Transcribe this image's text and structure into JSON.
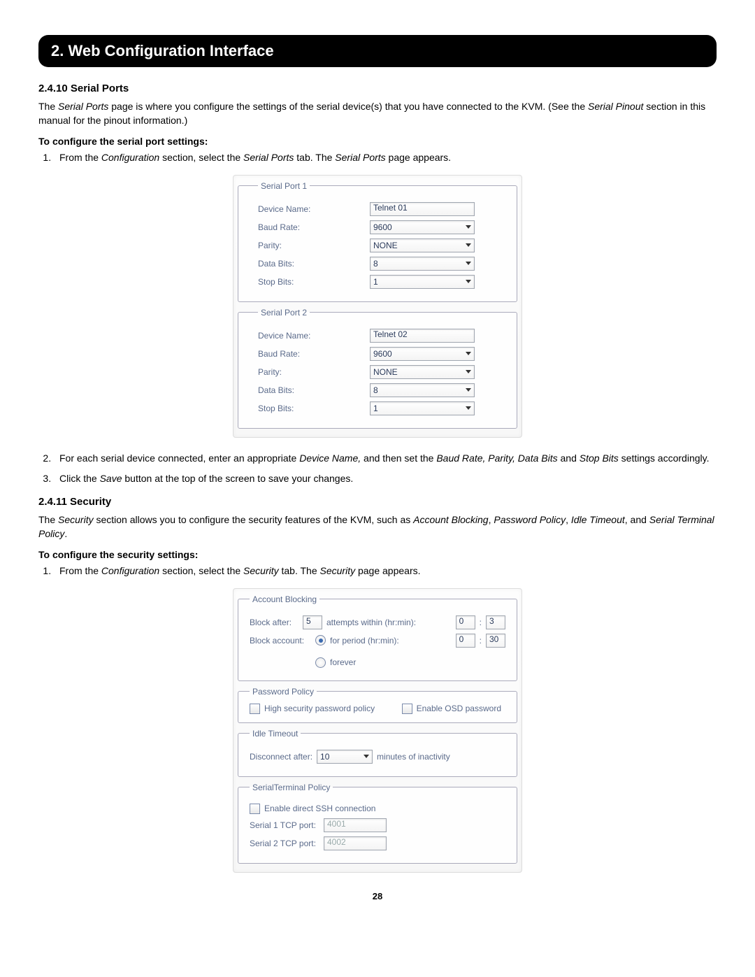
{
  "page": {
    "title_bar": "2. Web Configuration Interface",
    "page_number": "28"
  },
  "section_serial": {
    "heading": "2.4.10 Serial Ports",
    "intro_pre": "The ",
    "intro_i1": "Serial Ports",
    "intro_mid": " page is where you configure the settings of the serial device(s) that you have connected to the KVM. (See the ",
    "intro_i2": "Serial Pinout",
    "intro_post": " section in this manual for the pinout information.)",
    "sub": "To configure the serial port settings:",
    "step1_a": "From the ",
    "step1_i1": "Configuration",
    "step1_b": " section, select the ",
    "step1_i2": "Serial Ports",
    "step1_c": " tab. The ",
    "step1_i3": "Serial Ports",
    "step1_d": " page appears.",
    "step2_a": "For each serial device connected, enter an appropriate ",
    "step2_i1": "Device Name,",
    "step2_b": " and then set the ",
    "step2_i2": "Baud Rate, Parity, Data Bits",
    "step2_c": " and ",
    "step2_i3": "Stop Bits",
    "step2_d": " settings accordingly.",
    "step3_a": "Click the ",
    "step3_i1": "Save",
    "step3_b": " button at the top of the screen to save your changes."
  },
  "serial_form": {
    "ports": [
      {
        "legend": "Serial Port 1",
        "device_name_label": "Device Name:",
        "device_name_value": "Telnet 01",
        "baud_label": "Baud Rate:",
        "baud_value": "9600",
        "parity_label": "Parity:",
        "parity_value": "NONE",
        "data_label": "Data Bits:",
        "data_value": "8",
        "stop_label": "Stop Bits:",
        "stop_value": "1"
      },
      {
        "legend": "Serial Port 2",
        "device_name_label": "Device Name:",
        "device_name_value": "Telnet 02",
        "baud_label": "Baud Rate:",
        "baud_value": "9600",
        "parity_label": "Parity:",
        "parity_value": "NONE",
        "data_label": "Data Bits:",
        "data_value": "8",
        "stop_label": "Stop Bits:",
        "stop_value": "1"
      }
    ]
  },
  "section_security": {
    "heading": "2.4.11 Security",
    "intro_pre": "The ",
    "intro_i1": "Security",
    "intro_mid": " section allows you to configure the security features of the KVM, such as ",
    "intro_i2": "Account Blocking",
    "intro_c1": ", ",
    "intro_i3": "Password Policy",
    "intro_c2": ", ",
    "intro_i4": "Idle Timeout",
    "intro_c3": ", and ",
    "intro_i5": "Serial Terminal Policy",
    "intro_post": ".",
    "sub": "To configure the security settings:",
    "step1_a": "From the ",
    "step1_i1": "Configuration",
    "step1_b": " section, select the ",
    "step1_i2": "Security",
    "step1_c": " tab. The ",
    "step1_i3": "Security",
    "step1_d": " page appears."
  },
  "security_form": {
    "account_blocking": {
      "legend": "Account Blocking",
      "block_after_label": "Block after:",
      "block_after_value": "5",
      "attempts_label": "attempts within (hr:min):",
      "attempts_hr": "0",
      "attempts_sep": ":",
      "attempts_min": "3",
      "block_account_label": "Block account:",
      "for_period_label": "for period (hr:min):",
      "for_period_hr": "0",
      "for_period_sep": ":",
      "for_period_min": "30",
      "forever_label": "forever"
    },
    "password_policy": {
      "legend": "Password Policy",
      "high_sec_label": "High security password policy",
      "osd_label": "Enable OSD password"
    },
    "idle_timeout": {
      "legend": "Idle Timeout",
      "disconnect_label": "Disconnect after:",
      "disconnect_value": "10",
      "minutes_label": "minutes of inactivity"
    },
    "serial_terminal": {
      "legend": "SerialTerminal Policy",
      "ssh_label": "Enable direct SSH connection",
      "s1_label": "Serial 1 TCP port:",
      "s1_value": "4001",
      "s2_label": "Serial 2 TCP port:",
      "s2_value": "4002"
    }
  }
}
